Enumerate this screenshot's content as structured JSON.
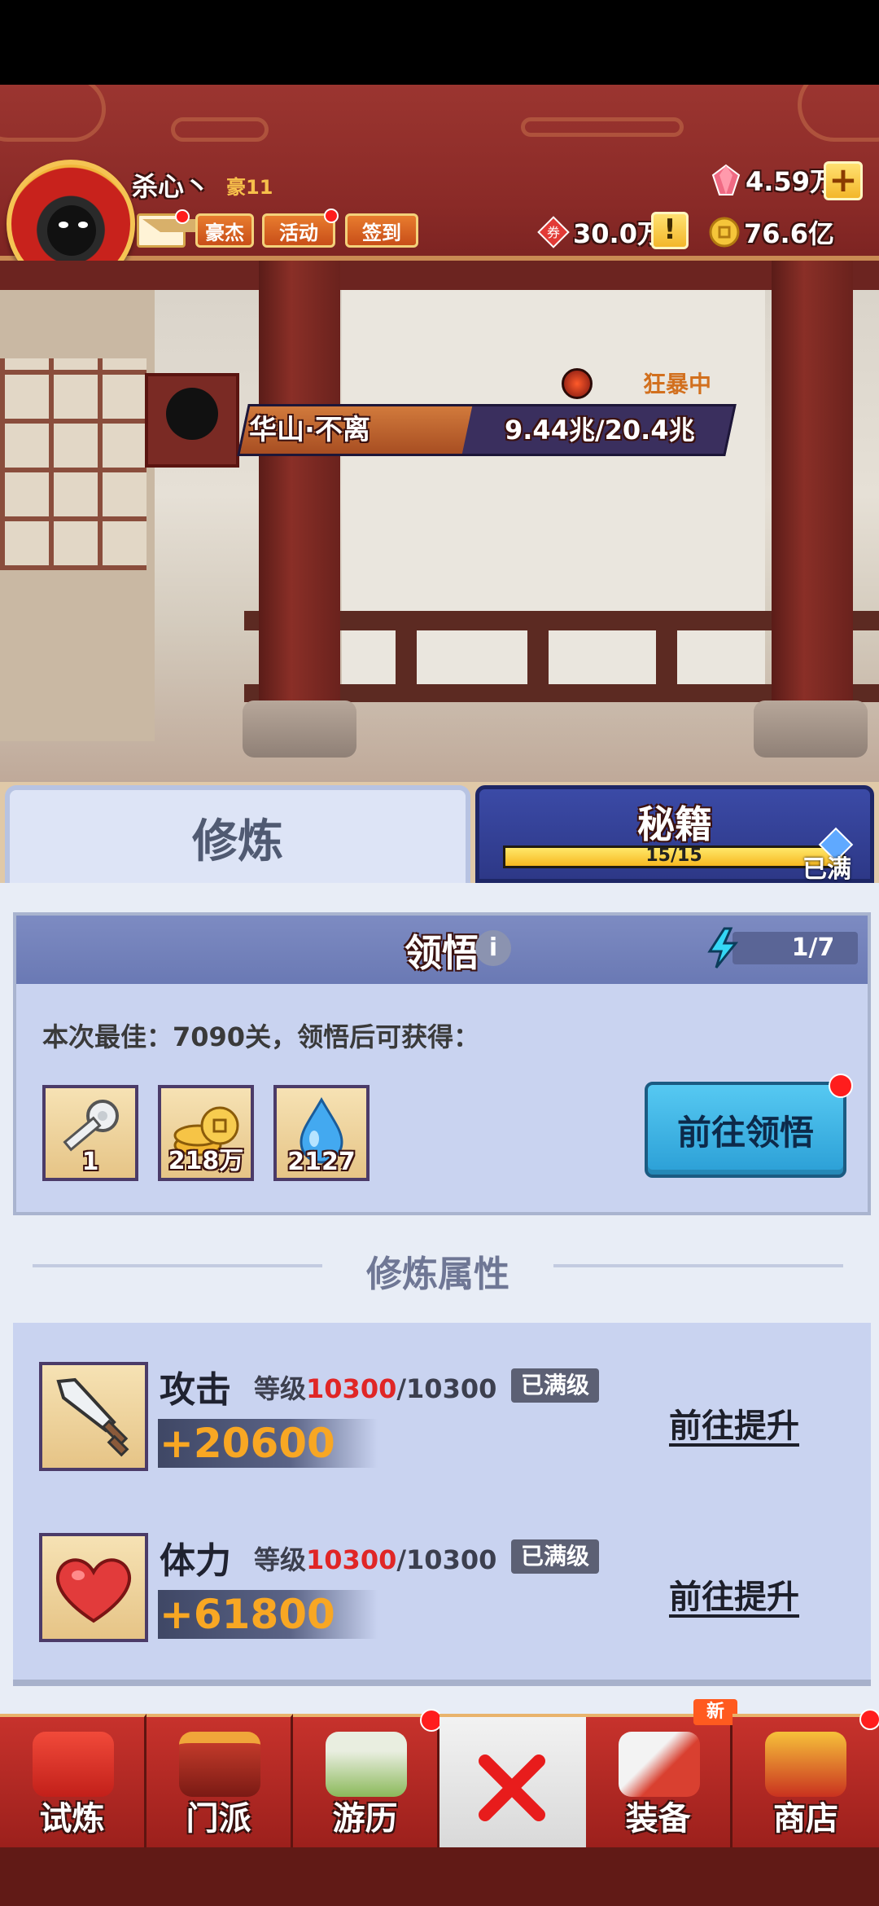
{
  "player": {
    "name": "杀心丶",
    "rank": "豪11"
  },
  "header_buttons": {
    "hero": "豪杰",
    "event": "活动",
    "signin": "签到"
  },
  "resources": {
    "gems": "4.59万",
    "vouchers": "30.0万",
    "coins": "76.6亿"
  },
  "boss": {
    "name": "华山·不离",
    "hp_text": "9.44兆/20.4兆",
    "hp_fraction": 0.46,
    "status": "狂暴中"
  },
  "tabs": {
    "cultivate": "修炼",
    "secret": "秘籍",
    "secret_progress": "15/15",
    "secret_fraction": 1.0,
    "secret_full": "已满"
  },
  "insight": {
    "title": "领悟",
    "info": "i",
    "energy": "1/7",
    "best_text": "本次最佳：7090关，领悟后可获得：",
    "rewards": [
      {
        "icon": "key-icon",
        "qty": "1"
      },
      {
        "icon": "coin-stack-icon",
        "qty": "218万"
      },
      {
        "icon": "water-drop-icon",
        "qty": "2127"
      }
    ],
    "go_button": "前往领悟"
  },
  "attributes": {
    "title": "修炼属性",
    "items": [
      {
        "icon": "sword-icon",
        "name": "攻击",
        "level_prefix": "等级",
        "level_cur": "10300",
        "level_max": "/10300",
        "maxed": "已满级",
        "value": "+20600",
        "action": "前往提升"
      },
      {
        "icon": "heart-icon",
        "name": "体力",
        "level_prefix": "等级",
        "level_cur": "10300",
        "level_max": "/10300",
        "maxed": "已满级",
        "value": "+61800",
        "action": "前往提升"
      }
    ]
  },
  "nav": {
    "trial": "试炼",
    "sect": "门派",
    "travel": "游历",
    "equip": "装备",
    "shop": "商店",
    "new_badge": "新"
  },
  "colors": {
    "header_red": "#9b3530",
    "accent_gold": "#f8a723",
    "panel_blue": "#c9d3f0",
    "level_red": "#e02626"
  }
}
